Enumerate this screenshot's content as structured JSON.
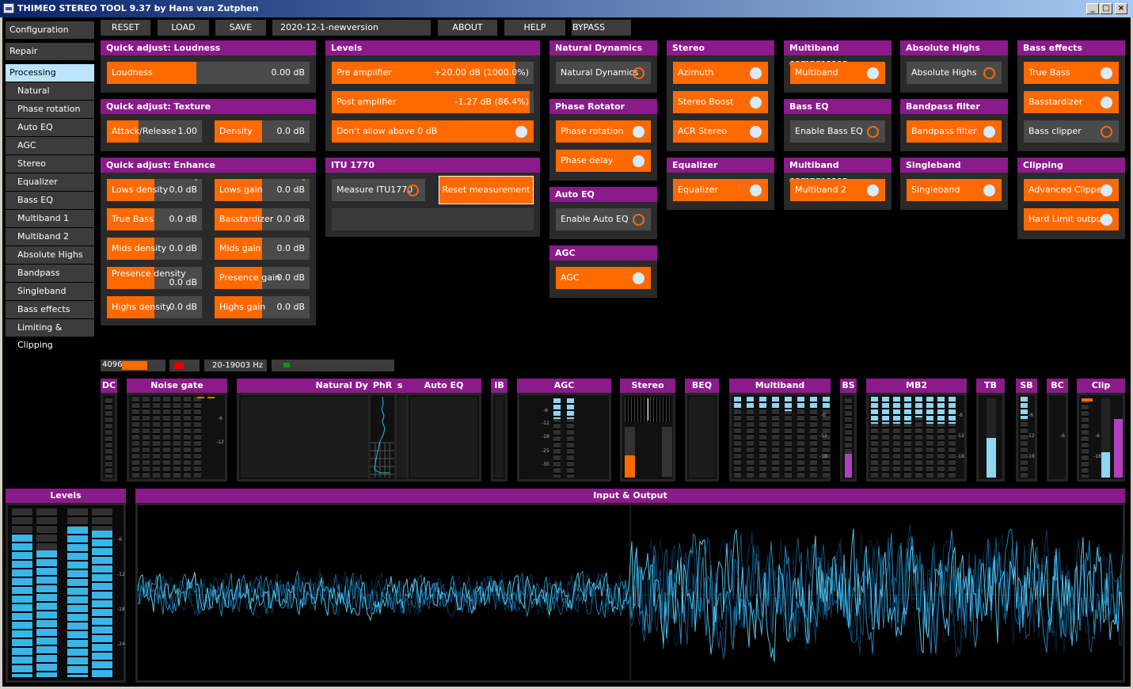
{
  "window": {
    "title": "THIMEO STEREO TOOL 9.37 by Hans van Zutphen"
  },
  "sidebar": {
    "items": [
      {
        "label": "Configuration"
      },
      {
        "label": "Repair"
      },
      {
        "label": "Processing"
      },
      {
        "label": "Natural Dynamics"
      },
      {
        "label": "Phase rotation"
      },
      {
        "label": "Auto EQ"
      },
      {
        "label": "AGC"
      },
      {
        "label": "Stereo"
      },
      {
        "label": "Equalizer"
      },
      {
        "label": "Bass EQ"
      },
      {
        "label": "Multiband 1"
      },
      {
        "label": "Multiband 2"
      },
      {
        "label": "Absolute Highs"
      },
      {
        "label": "Bandpass"
      },
      {
        "label": "Singleband"
      },
      {
        "label": "Bass effects"
      },
      {
        "label": "Limiting & Clipping"
      }
    ],
    "selected": "Processing"
  },
  "toolbar": {
    "reset": "RESET",
    "load": "LOAD",
    "save": "SAVE",
    "preset": "2020-12-1-newversion",
    "about": "ABOUT",
    "help": "HELP",
    "bypass": "BYPASS"
  },
  "loudness": {
    "title": "Quick adjust: Loudness",
    "label": "Loudness",
    "value": "0.00 dB",
    "level": 0.44
  },
  "texture": {
    "title": "Quick adjust: Texture",
    "attack_label": "Attack/Release",
    "attack_value": "1.00",
    "attack_level": 0.33,
    "density_label": "Density",
    "density_value": "0.0 dB",
    "density_level": 0.5
  },
  "enhance": {
    "title": "Quick adjust: Enhance",
    "items": [
      {
        "label": "Lows density",
        "value": "0.0 dB",
        "level": 0.5
      },
      {
        "label": "Lows gain",
        "value": "0.0 dB",
        "level": 0.5
      },
      {
        "label": "True Bass",
        "value": "0.0 dB",
        "level": 0.5
      },
      {
        "label": "Basstardizer",
        "value": "0.0 dB",
        "level": 0.5
      },
      {
        "label": "Mids density",
        "value": "0.0 dB",
        "level": 0.5
      },
      {
        "label": "Mids gain",
        "value": "0.0 dB",
        "level": 0.5
      },
      {
        "label": "Presence density",
        "value": "0.0 dB",
        "level": 0.5
      },
      {
        "label": "Presence gain",
        "value": "0.0 dB",
        "level": 0.5
      },
      {
        "label": "Highs density",
        "value": "0.0 dB",
        "level": 0.5
      },
      {
        "label": "Highs gain",
        "value": "0.0 dB",
        "level": 0.5
      }
    ]
  },
  "levels_panel": {
    "title": "Levels",
    "pre_label": "Pre amplifier",
    "pre_value": "+20.00 dB (1000.0%)",
    "pre_level": 0.91,
    "post_label": "Post amplifier",
    "post_value": "-1.27 dB (86.4%)",
    "post_level": 0.98,
    "limit_label": "Don't allow above 0 dB",
    "limit_on": true
  },
  "itu": {
    "title": "ITU 1770",
    "measure_label": "Measure ITU1770",
    "measure_on": false,
    "reset_label": "Reset measurement"
  },
  "natural_dynamics": {
    "title": "Natural Dynamics",
    "label": "Natural Dynamics",
    "on": false
  },
  "phase_rotator": {
    "title": "Phase Rotator",
    "rotation_label": "Phase rotation",
    "delay_label": "Phase delay"
  },
  "auto_eq": {
    "title": "Auto EQ",
    "label": "Enable Auto EQ",
    "on": false
  },
  "agc": {
    "title": "AGC",
    "label": "AGC",
    "on": true
  },
  "stereo": {
    "title": "Stereo",
    "azimuth": "Azimuth",
    "boost": "Stereo Boost",
    "acr": "ACR Stereo"
  },
  "equalizer": {
    "title": "Equalizer",
    "label": "Equalizer"
  },
  "multiband1": {
    "title": "Multiband compressor",
    "label": "Multiband"
  },
  "bass_eq": {
    "title": "Bass EQ",
    "label": "Enable Bass EQ",
    "on": false
  },
  "multiband2": {
    "title": "Multiband compressor",
    "label": "Multiband 2"
  },
  "absolute_highs": {
    "title": "Absolute Highs",
    "label": "Absolute Highs",
    "on": false
  },
  "bandpass": {
    "title": "Bandpass filter",
    "label": "Bandpass filter"
  },
  "singleband": {
    "title": "Singleband",
    "label": "Singleband"
  },
  "bass_effects": {
    "title": "Bass effects",
    "true_bass": "True Bass",
    "basstardizer": "Basstardizer",
    "bass_clipper": "Bass clipper"
  },
  "clipping": {
    "title": "Clipping",
    "advanced": "Advanced Clipper",
    "hard_limit": "Hard Limit output"
  },
  "status": {
    "fft": "4096",
    "freq": "20-19003 Hz"
  },
  "meters": {
    "dc": "DC",
    "noise_gate": "Noise gate",
    "natural_dynamics": "Natural Dynamics",
    "phr": "PhR",
    "auto_eq": "Auto EQ",
    "ib": "IB",
    "agc": "AGC",
    "stereo": "Stereo",
    "beq": "BEQ",
    "multiband": "Multiband",
    "bs": "BS",
    "mb2": "MB2",
    "tb": "TB",
    "sb": "SB",
    "bc": "BC",
    "clip": "Clip"
  },
  "scale": {
    "m6": "-6",
    "m12": "-12",
    "m18": "-18",
    "m24": "-24",
    "m25": "-25",
    "m30": "-30"
  },
  "levels_meter": {
    "title": "Levels"
  },
  "io": {
    "title": "Input & Output"
  },
  "colors": {
    "accent": "#ff6a00",
    "header": "#8b1a8b",
    "meter": "#8ed6f2",
    "selected": "#bde4ff"
  }
}
